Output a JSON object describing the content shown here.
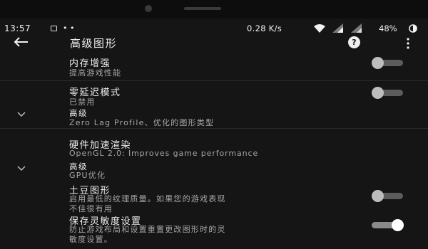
{
  "status_bar": {
    "time": "13:57",
    "more_notifications": "• •",
    "net_speed": "0.28 K/s",
    "battery_pct": "48%"
  },
  "app_bar": {
    "title": "高级图形",
    "help_label": "?"
  },
  "settings": [
    {
      "title": "内存增强",
      "subtitle": "提高游戏性能",
      "toggle": "off"
    },
    {
      "title": "零延迟模式",
      "subtitle": "已禁用",
      "toggle": "off"
    },
    {
      "title": "高级",
      "subtitle": "Zero Lag Profile、优化的图形类型"
    },
    {
      "title": "硬件加速渲染",
      "subtitle": "OpenGL 2.0: Improves game performance"
    },
    {
      "title": "高级",
      "subtitle": "GPU优化"
    },
    {
      "title": "土豆图形",
      "subtitle_line1": "启用最低的纹理质量。如果您的游戏表现",
      "subtitle_line2": "不佳很有用",
      "toggle": "off"
    },
    {
      "title": "保存灵敏度设置",
      "subtitle_line1": "防止游戏布局和设置重置更改图形时的灵",
      "subtitle_line2": "敏度设置。",
      "toggle": "on"
    }
  ],
  "icons": {
    "back": "arrow-left-icon",
    "help": "help-circle-icon",
    "more": "more-vert-icon",
    "expand": "chevron-down-icon",
    "wifi": "wifi-icon",
    "signal": "signal-icon",
    "battery": "battery-icon"
  }
}
